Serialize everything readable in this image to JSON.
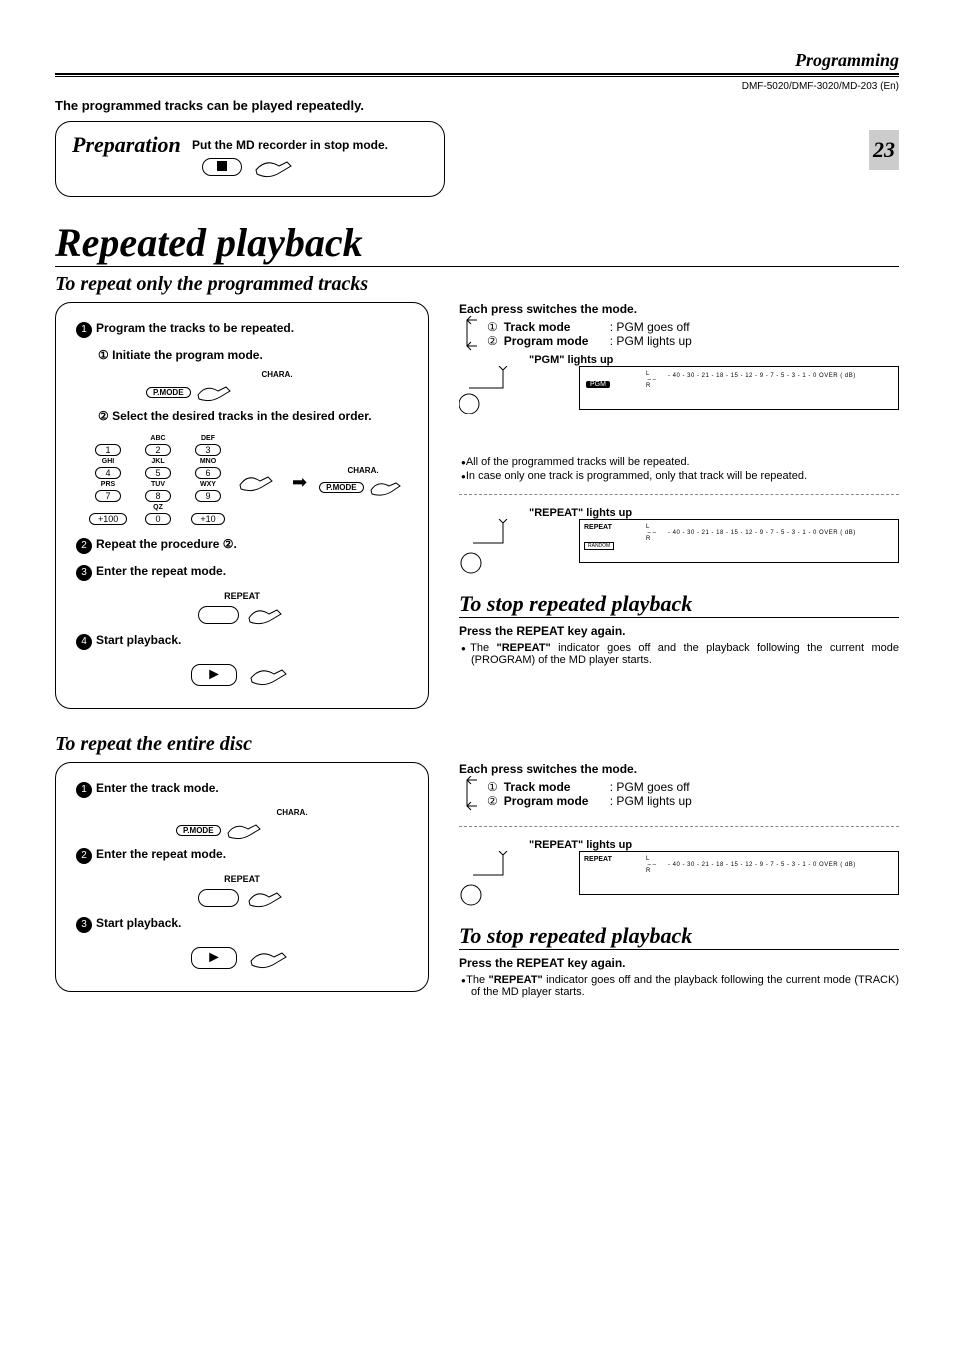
{
  "header": {
    "section": "Programming",
    "models": "DMF-5020/DMF-3020/MD-203 (En)",
    "page": "23"
  },
  "intro": "The programmed tracks can be played repeatedly.",
  "prep": {
    "title": "Preparation",
    "instruction": "Put the MD recorder in stop mode."
  },
  "title": "Repeated playback",
  "sec1": {
    "subtitle": "To repeat only the programmed tracks",
    "s1": "Program the tracks to be repeated.",
    "s1a": "Initiate the program mode.",
    "chara": "CHARA.",
    "pmode": "P.MODE",
    "s1b": "Select the desired tracks in the desired order.",
    "keycols": [
      "",
      "ABC",
      "DEF",
      "GHI",
      "JKL",
      "MNO",
      "PRS",
      "TUV",
      "WXY",
      "",
      "QZ",
      ""
    ],
    "keys": [
      "1",
      "2",
      "3",
      "4",
      "5",
      "6",
      "7",
      "8",
      "9",
      "+100",
      "0",
      "+10"
    ],
    "s2": "Repeat the procedure ②.",
    "s3": "Enter the repeat mode.",
    "repeat_lbl": "REPEAT",
    "s4": "Start playback."
  },
  "right1": {
    "each": "Each press switches the mode.",
    "m1_label": "Track mode",
    "m1_desc": ": PGM goes off",
    "m2_label": "Program mode",
    "m2_desc": ": PGM lights up",
    "pgm_lights": "\"PGM\" lights up",
    "repeat_lights": "\"REPEAT\" lights up",
    "disp_scale": "- 40  - 30  - 21  - 18  - 15  - 12  - 9   - 7   - 5   - 3   - 1   - 0   OVER ( dB)",
    "n1": "All of the programmed tracks will be repeated.",
    "n2": "In case only one track is programmed, only that track will be repeated.",
    "stop_title": "To stop repeated playback",
    "stop_sub": "Press the REPEAT key again.",
    "stop_note_a": "The ",
    "stop_note_b": "\"REPEAT\"",
    "stop_note_c": " indicator goes off and the playback following the current mode (PROGRAM) of the MD player starts."
  },
  "sec2": {
    "subtitle": "To repeat the entire disc",
    "s1": "Enter the track mode.",
    "s2": "Enter the repeat mode.",
    "s3": "Start playback."
  },
  "right2": {
    "stop_note_c": " indicator goes off and the playback following the current mode (TRACK) of the MD player starts."
  }
}
